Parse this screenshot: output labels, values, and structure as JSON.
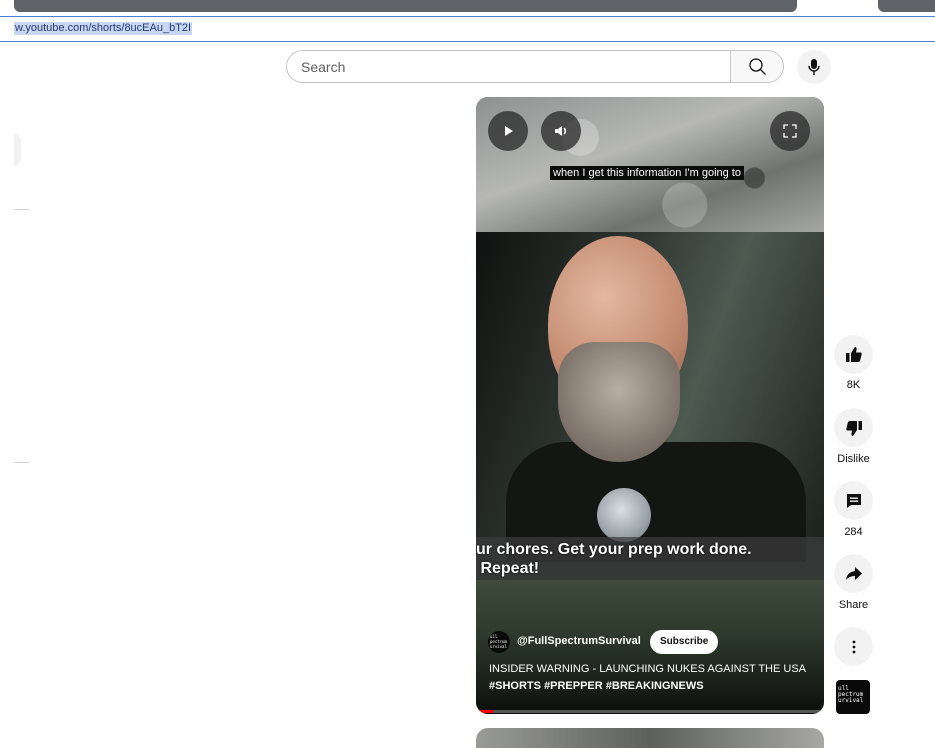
{
  "browser": {
    "url": "w.youtube.com/shorts/8ucEAu_bT2I"
  },
  "search": {
    "placeholder": "Search",
    "value": ""
  },
  "video": {
    "subtitle": "when I get this information I'm going to",
    "caption": "ur chores. Get your prep work done.\n Repeat!",
    "channel": "@FullSpectrumSurvival",
    "channel_logo_text": "ull\npectrum\nurvival",
    "subscribe_label": "Subscribe",
    "title_line1": "INSIDER WARNING - LAUNCHING NUKES AGAINST THE USA",
    "title_line2": "#SHORTS #PREPPER #BREAKINGNEWS",
    "progress_fraction": 0.05,
    "progress_color": "#ff0000"
  },
  "actions": {
    "like_count": "8K",
    "dislike_label": "Dislike",
    "comment_count": "284",
    "share_label": "Share"
  },
  "icons": [
    "search-icon",
    "mic-icon",
    "play-icon",
    "volume-icon",
    "fullscreen-icon",
    "thumbs-up-icon",
    "thumbs-down-icon",
    "comment-icon",
    "share-icon",
    "more-icon"
  ]
}
